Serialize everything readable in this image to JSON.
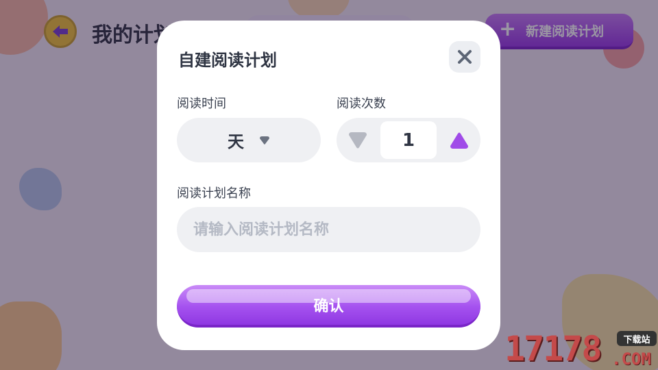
{
  "background": {
    "page_title": "我的计划",
    "new_plan_button": "新建阅读计划"
  },
  "modal": {
    "title": "自建阅读计划",
    "reading_time": {
      "label": "阅读时间",
      "selected": "天"
    },
    "reading_count": {
      "label": "阅读次数",
      "value": "1"
    },
    "plan_name": {
      "label": "阅读计划名称",
      "placeholder": "请输入阅读计划名称",
      "value": ""
    },
    "confirm_button": "确认"
  },
  "watermark": {
    "number": "17178",
    "tag": "下载站",
    "domain": ".COM"
  },
  "colors": {
    "accent_purple": "#a552ef",
    "title_text": "#2f3543",
    "field_bg": "#eff0f3",
    "placeholder": "#b4b9c4"
  },
  "icons": {
    "back": "back-arrow-icon",
    "close": "close-icon",
    "dropdown": "chevron-down-icon",
    "decrement": "triangle-down-icon",
    "increment": "triangle-up-icon",
    "add": "plus-icon"
  }
}
